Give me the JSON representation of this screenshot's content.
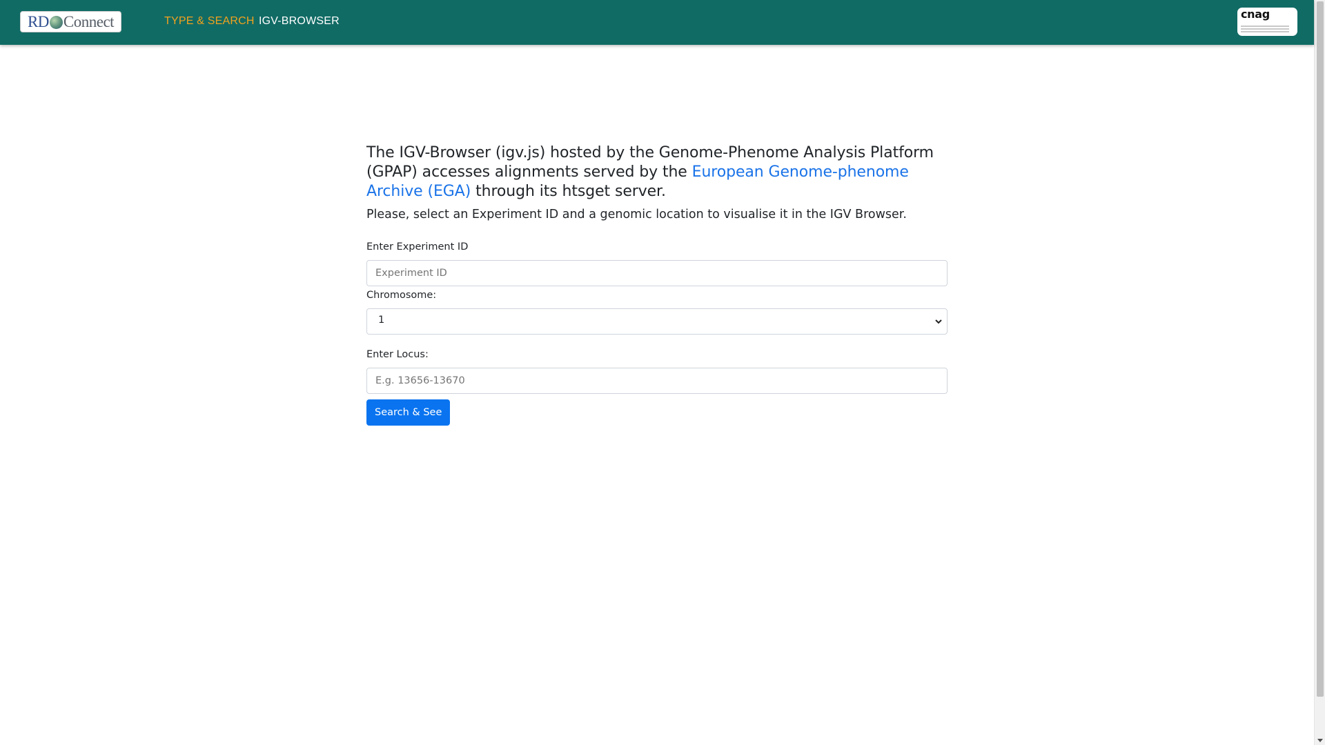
{
  "navbar": {
    "brand_logo": {
      "rd": "RD",
      "connect": "Connect"
    },
    "links": {
      "type_search": "TYPE & SEARCH",
      "igv_browser": "IGV-BROWSER"
    },
    "partner_logo": {
      "text": "cnag"
    },
    "colors": {
      "background": "#116b65",
      "active_link": "#f0a21d",
      "link": "#ffffff"
    }
  },
  "intro": {
    "heading_part1": "The IGV-Browser (igv.js) hosted by the Genome-Phenome Analysis Platform (GPAP) accesses alignments served by the ",
    "ega_link": "European Genome-phenome Archive (EGA)",
    "heading_part2": " through its htsget server.",
    "instruction": "Please, select an Experiment ID and a genomic location to visualise it in the IGV Browser."
  },
  "form": {
    "experiment_label": "Enter Experiment ID",
    "experiment_value": "",
    "experiment_placeholder": "Experiment ID",
    "chromosome_label": "Chromosome:",
    "chromosome_selected": "1",
    "locus_label": "Enter Locus:",
    "locus_value": "",
    "locus_placeholder": "E.g. 13656-13670",
    "submit_label": "Search & See"
  },
  "icons": {
    "select_caret": "chevron-down-icon"
  }
}
